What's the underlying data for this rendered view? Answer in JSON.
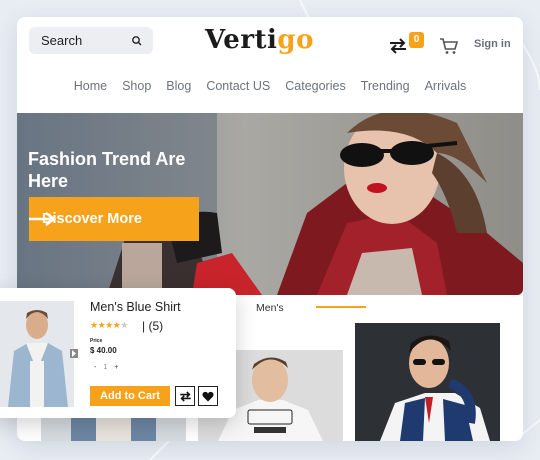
{
  "header": {
    "search_label": "Search",
    "logo_main": "Verti",
    "logo_accent": "go",
    "compare_count": "0",
    "signin": "Sign in"
  },
  "nav": [
    "Home",
    "Shop",
    "Blog",
    "Contact US",
    "Categories",
    "Trending",
    "Arrivals"
  ],
  "hero": {
    "title": "Fashion Trend Are Here",
    "button": "Discover More"
  },
  "tabs": {
    "active": "Men's"
  },
  "popup": {
    "name": "Men's Blue Shirt",
    "rating": 4,
    "rating_max": 5,
    "review_count": "| (5)",
    "price_label": "Price",
    "price": "$ 40.00",
    "qty_minus": "-",
    "qty_value": "1",
    "qty_plus": "+",
    "add_to_cart": "Add to Cart"
  },
  "colors": {
    "accent": "#f7a21b",
    "text": "#222222",
    "nav_text": "#6d737b"
  },
  "icons": [
    "search-icon",
    "compare-icon",
    "cart-icon",
    "arrow-right-icon",
    "heart-icon",
    "star-icon"
  ]
}
